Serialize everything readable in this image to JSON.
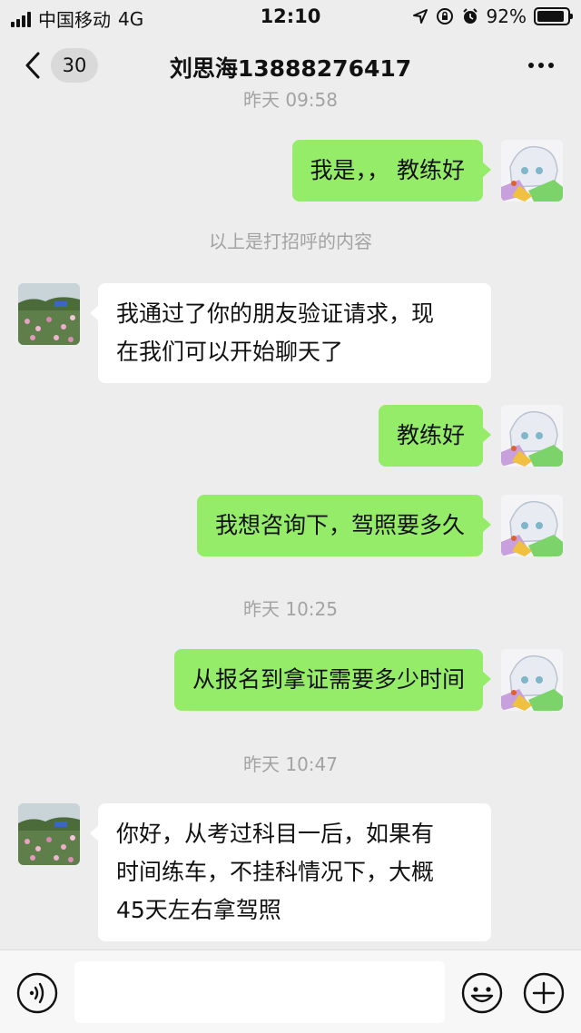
{
  "status_bar": {
    "carrier": "中国移动",
    "network": "4G",
    "time": "12:10",
    "battery": "92%",
    "battery_level": 0.92
  },
  "nav": {
    "unread_count": "30",
    "title": "刘思海13888276417"
  },
  "messages": [
    {
      "type": "timestamp",
      "text": "昨天 09:58"
    },
    {
      "type": "sent",
      "lines": [
        "我是，，  教练好"
      ]
    },
    {
      "type": "system",
      "text": "以上是打招呼的内容"
    },
    {
      "type": "received",
      "lines": [
        "我通过了你的朋友验证请求，现",
        "在我们可以开始聊天了"
      ]
    },
    {
      "type": "sent",
      "lines": [
        "教练好"
      ]
    },
    {
      "type": "sent",
      "lines": [
        "我想咨询下，驾照要多久"
      ]
    },
    {
      "type": "timestamp",
      "text": "昨天 10:25"
    },
    {
      "type": "sent",
      "lines": [
        "从报名到拿证需要多少时间"
      ]
    },
    {
      "type": "timestamp",
      "text": "昨天 10:47"
    },
    {
      "type": "received",
      "lines": [
        "你好，从考过科目一后，如果有",
        "时间练车，不挂科情况下，大概",
        "45天左右拿驾照"
      ]
    }
  ],
  "input": {
    "text": ""
  },
  "colors": {
    "background": "#ededed",
    "sent_bubble": "#95ec69",
    "received_bubble": "#ffffff",
    "timestamp_text": "#a3a3a3"
  },
  "icons": {
    "back": "chevron-left-icon",
    "more": "more-dots-icon",
    "voice": "voice-icon",
    "emoji": "emoji-icon",
    "plus": "plus-icon"
  }
}
